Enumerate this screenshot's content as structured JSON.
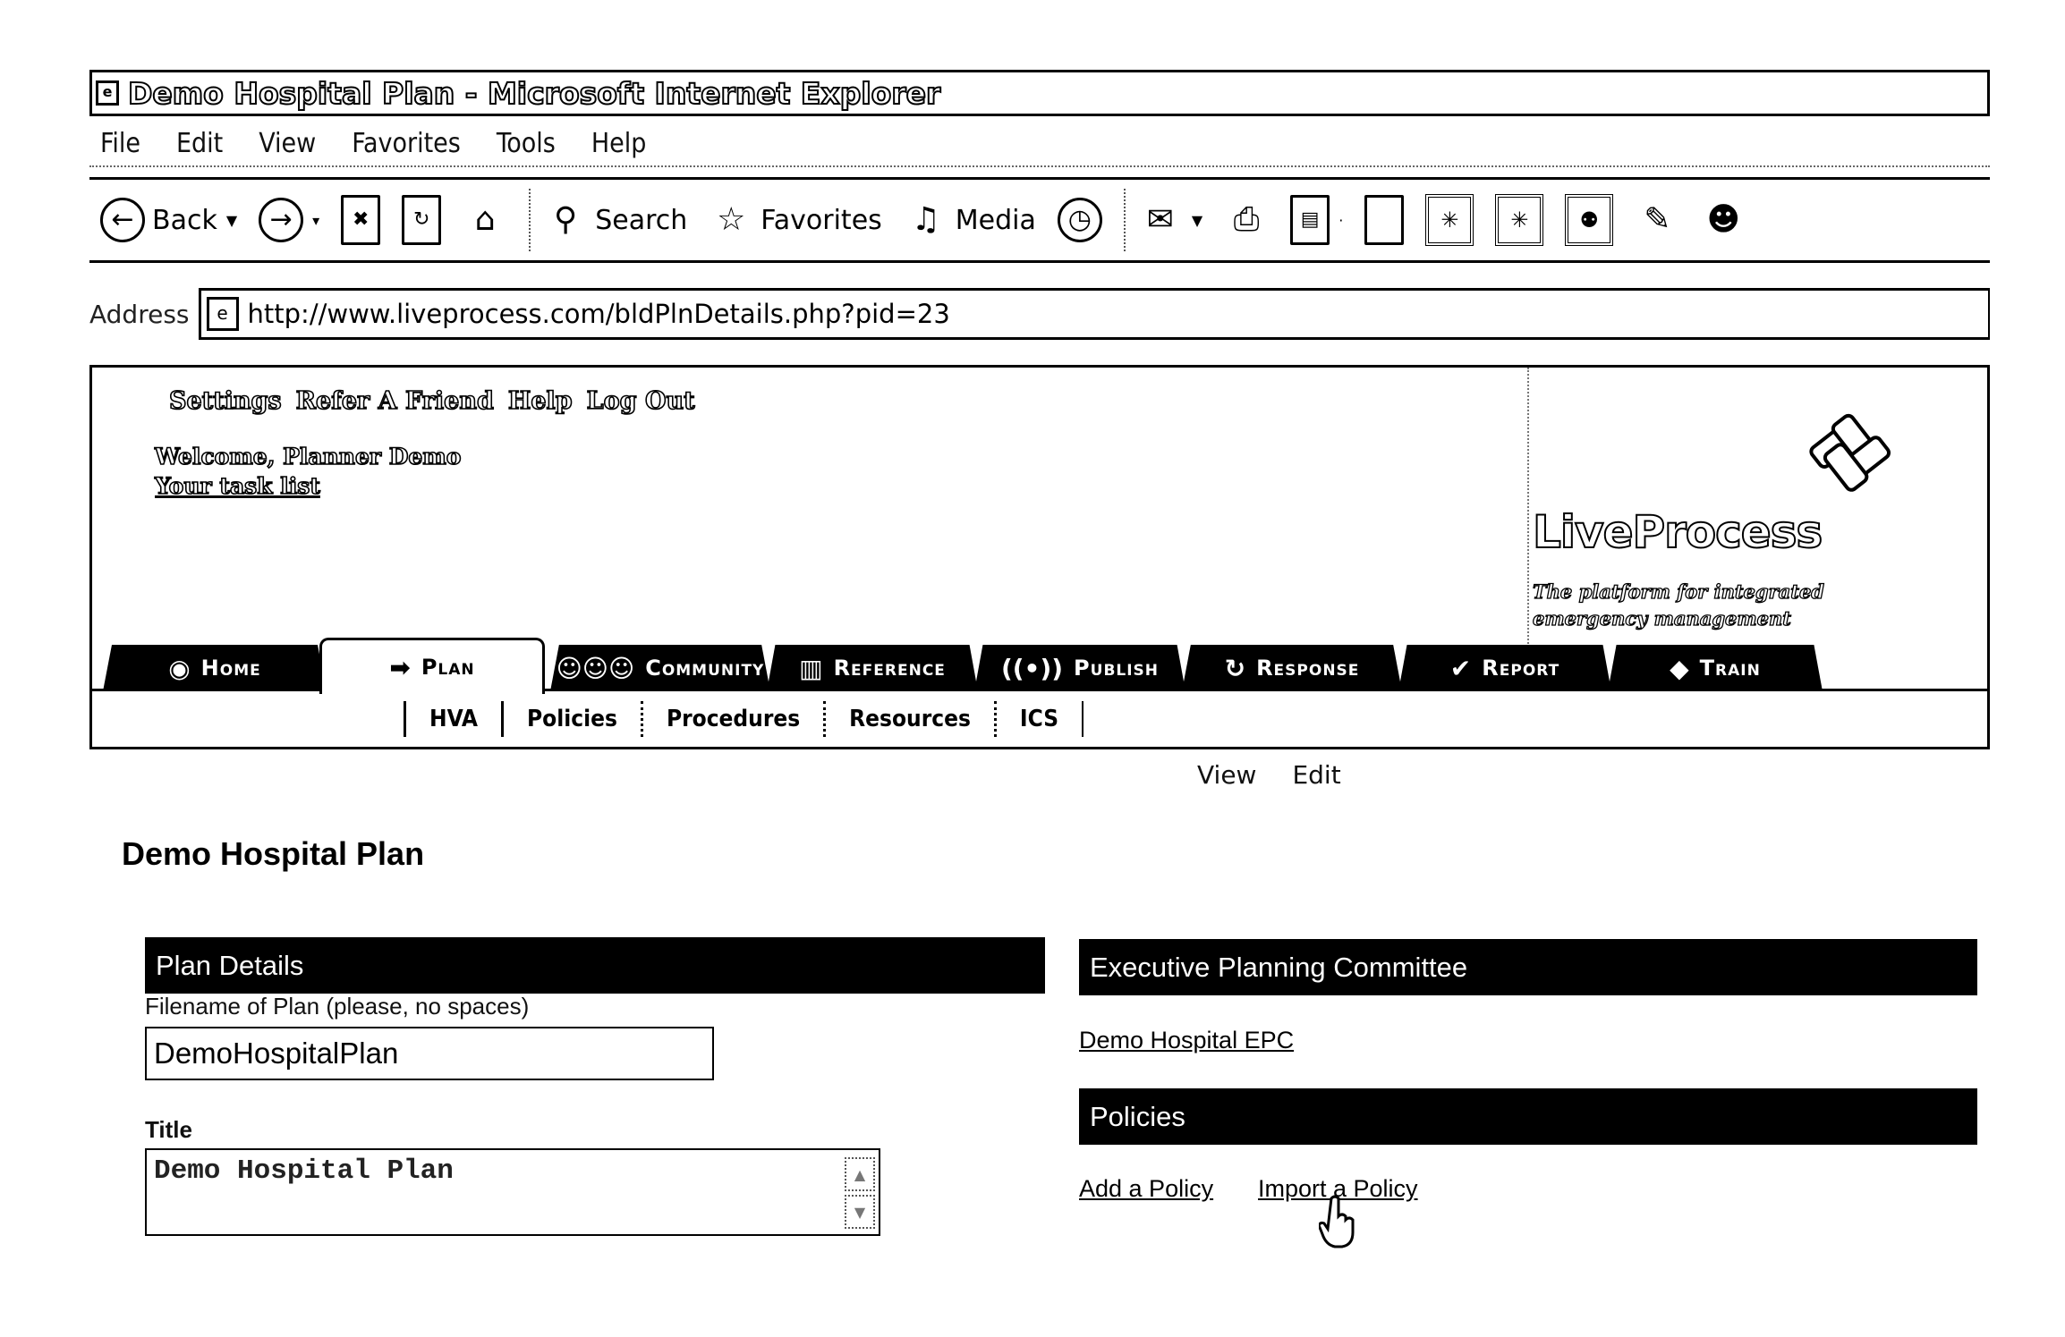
{
  "browser": {
    "window_title": "Demo Hospital Plan - Microsoft Internet Explorer",
    "menu": [
      "File",
      "Edit",
      "View",
      "Favorites",
      "Tools",
      "Help"
    ],
    "toolbar": {
      "back_label": "Back",
      "search_label": "Search",
      "favorites_label": "Favorites",
      "media_label": "Media",
      "icons": {
        "back": "back-arrow-icon",
        "forward": "forward-arrow-icon",
        "stop": "stop-icon",
        "refresh": "refresh-icon",
        "home": "home-icon",
        "search": "magnifier-icon",
        "favorites": "star-icon",
        "media": "media-icon",
        "history": "history-icon",
        "mail": "mail-icon",
        "print": "print-icon",
        "edit": "edit-icon",
        "discuss": "discuss-icon",
        "messenger": "messenger-icon"
      }
    },
    "address_label": "Address",
    "address_url": "http://www.liveprocess.com/bldPlnDetails.php?pid=23"
  },
  "site": {
    "header_links": [
      "Settings",
      "Refer A Friend",
      "Help",
      "Log Out"
    ],
    "welcome": "Welcome, Planner Demo",
    "task_list": "Your task list",
    "logo_text": "LiveProcess",
    "logo_tagline": "The platform for integrated emergency management",
    "tabs": [
      {
        "label": "Home",
        "icon": "◉",
        "active": false
      },
      {
        "label": "Plan",
        "icon": "➡",
        "active": true
      },
      {
        "label": "Community",
        "icon": "☺☺☺",
        "active": false
      },
      {
        "label": "Reference",
        "icon": "▥",
        "active": false
      },
      {
        "label": "Publish",
        "icon": "((•))",
        "active": false
      },
      {
        "label": "Response",
        "icon": "↻",
        "active": false
      },
      {
        "label": "Report",
        "icon": "✔",
        "active": false
      },
      {
        "label": "Train",
        "icon": "◆",
        "active": false
      }
    ],
    "subnav": [
      "HVA",
      "Policies",
      "Procedures",
      "Resources",
      "ICS"
    ],
    "view_label": "View",
    "edit_label": "Edit"
  },
  "page": {
    "title": "Demo Hospital Plan",
    "plan_details": {
      "header": "Plan Details",
      "filename_label": "Filename of Plan (please, no spaces)",
      "filename_value": "DemoHospitalPlan",
      "title_label": "Title",
      "title_value": "Demo Hospital Plan"
    },
    "epc": {
      "header": "Executive Planning Committee",
      "link": "Demo Hospital EPC"
    },
    "policies": {
      "header": "Policies",
      "add_link": "Add a Policy",
      "import_link": "Import a Policy"
    }
  }
}
